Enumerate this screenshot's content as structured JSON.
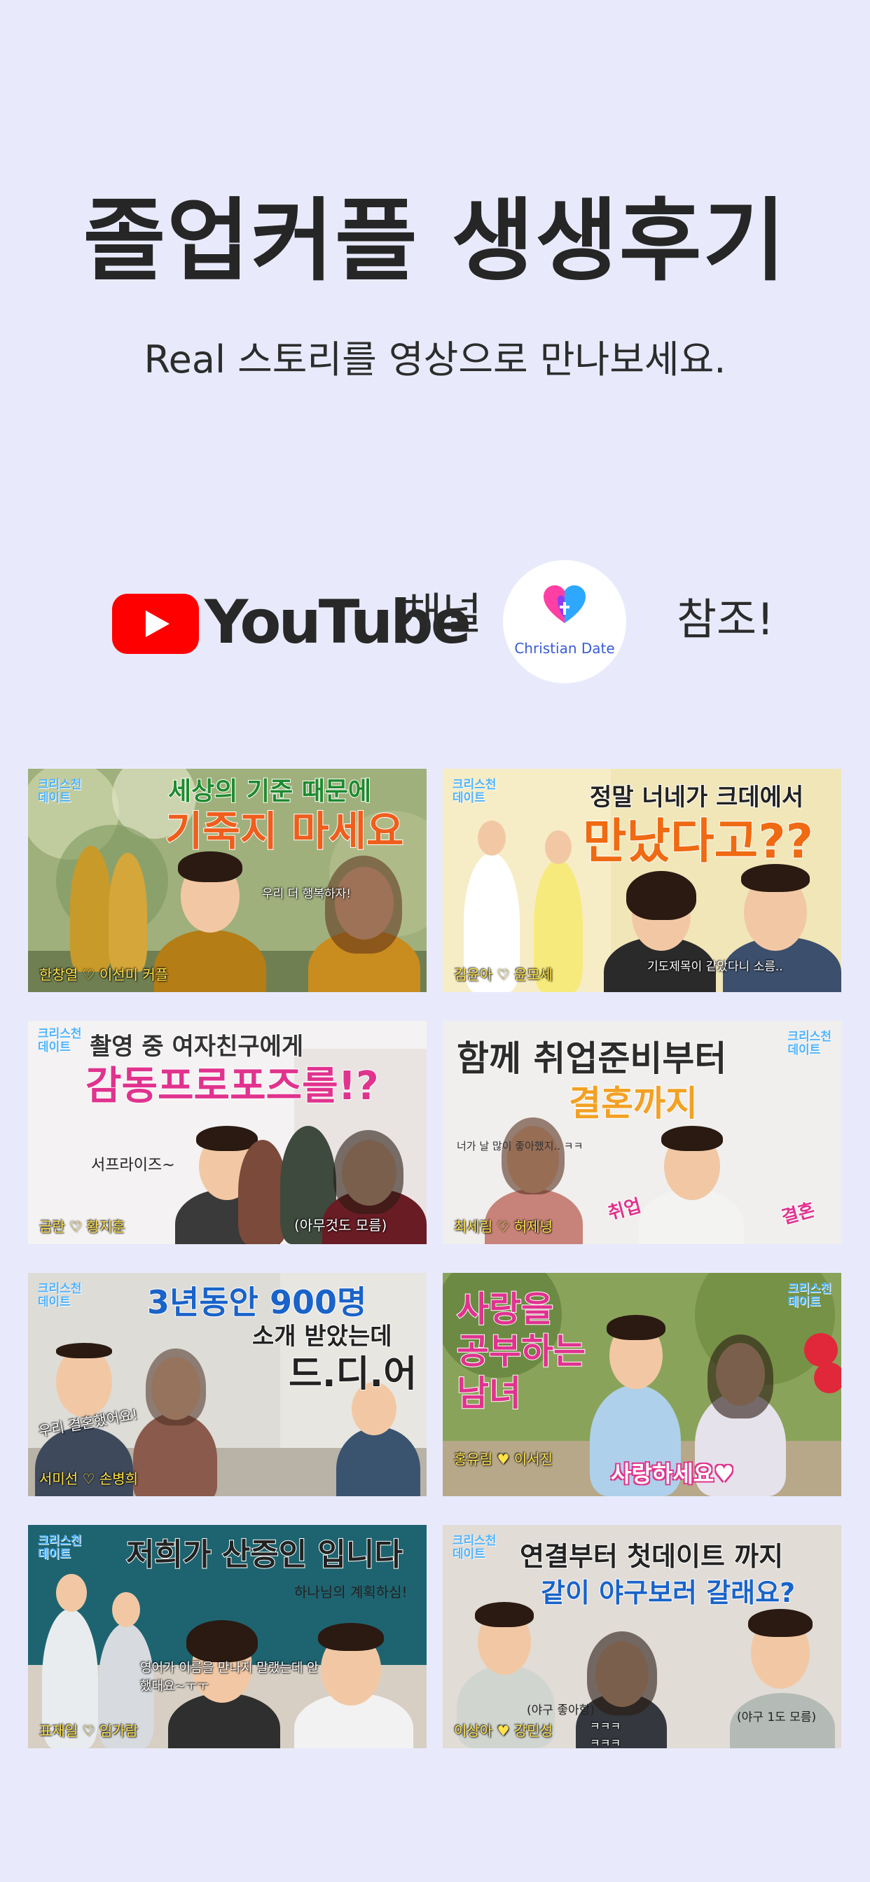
{
  "header": {
    "title": "졸업커플 생생후기",
    "subtitle": "Real 스토리를 영상으로 만나보세요."
  },
  "channel": {
    "youtube_wordmark": "YouTube",
    "channel_label": "채널",
    "brand_name": "Christian Date",
    "refer_label": "참조!",
    "youtube_color": "#FF0000",
    "brand_color": "#3A5BD6"
  },
  "videos": [
    {
      "logo": "크리스천\n데이트",
      "line1": "세상의 기준 때문에",
      "line2": "기죽지 마세요",
      "caption": "우리 더 행복하자!",
      "names": "한창열 ♡ 이선미 커플"
    },
    {
      "logo": "크리스천\n데이트",
      "line1": "정말 너네가 크데에서",
      "line2": "만났다고??",
      "caption": "기도제목이 같았다니 소름..",
      "names": "김윤아 ♡ 윤모세"
    },
    {
      "logo": "크리스천\n데이트",
      "line1": "촬영 중 여자친구에게",
      "line2": "감동프로포즈를!?",
      "caption": "서프라이즈~",
      "caption2": "(아무것도 모름)",
      "names": "금란 ♡ 황지훈"
    },
    {
      "logo": "크리스천\n데이트",
      "line1": "함께 취업준비부터",
      "line2": "결혼까지",
      "caption": "너가 날 많이 좋아했지.. ㅋㅋ",
      "tag1": "취업",
      "tag2": "결혼",
      "names": "최세림 ♡ 허제녕"
    },
    {
      "logo": "크리스천\n데이트",
      "line1": "3년동안 900명",
      "line2": "소개 받았는데",
      "line3": "드.디.어",
      "caption": "우리 결혼했어요!",
      "names": "서미선 ♡ 손병희"
    },
    {
      "logo": "크리스천\n데이트",
      "line1": "사랑을",
      "line2": "공부하는",
      "line3": "남녀",
      "caption": "사랑하세요♥",
      "names": "홍유림 ♥ 이서진"
    },
    {
      "logo": "크리스천\n데이트",
      "line1": "저희가 산증인 입니다",
      "line2": "하나님의 계획하심!",
      "caption": "영어가 이름을 만나지 말랬는데 안했대요~ㅜㅜ",
      "names": "표재일 ♡ 임가람"
    },
    {
      "logo": "크리스천\n데이트",
      "line1": "연결부터 첫데이트 까지",
      "line2": "같이 야구보러 갈래요?",
      "caption": "(야구 좋아함)",
      "caption2": "(야구 1도 모름)",
      "laugh": "ㅋㅋㅋ\nㅋㅋㅋ",
      "names": "이상아 ♥ 강민성"
    }
  ]
}
